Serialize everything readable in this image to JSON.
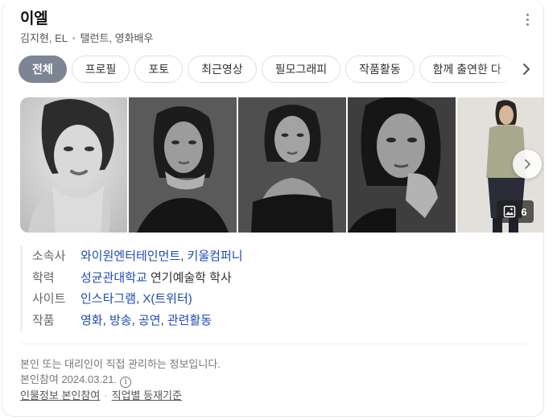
{
  "header": {
    "title": "이엘",
    "subtitle_names": "김지현, EL",
    "subtitle_role": "탤런트, 영화배우"
  },
  "tabs": [
    {
      "label": "전체",
      "active": true
    },
    {
      "label": "프로필"
    },
    {
      "label": "포토"
    },
    {
      "label": "최근영상"
    },
    {
      "label": "필모그래피"
    },
    {
      "label": "작품활동"
    },
    {
      "label": "함께 출연한 다"
    }
  ],
  "gallery": {
    "photo_count": "6",
    "icons": {
      "next": "chevron-right-icon",
      "count": "image-icon"
    }
  },
  "info": [
    {
      "label": "소속사",
      "values": [
        {
          "text": "와이원엔터테인먼트",
          "link": true
        },
        {
          "text": ", ",
          "link": false
        },
        {
          "text": "키울컴퍼니",
          "link": true
        }
      ]
    },
    {
      "label": "학력",
      "values": [
        {
          "text": "성균관대학교",
          "link": true
        },
        {
          "text": " 연기예술학 학사",
          "link": false
        }
      ]
    },
    {
      "label": "사이트",
      "values": [
        {
          "text": "인스타그램",
          "link": true
        },
        {
          "text": ", ",
          "link": false
        },
        {
          "text": "X(트위터)",
          "link": true
        }
      ]
    },
    {
      "label": "작품",
      "values": [
        {
          "text": "영화",
          "link": true
        },
        {
          "text": ", ",
          "link": false
        },
        {
          "text": "방송",
          "link": true
        },
        {
          "text": ", ",
          "link": false
        },
        {
          "text": "공연",
          "link": true
        },
        {
          "text": ", ",
          "link": false
        },
        {
          "text": "관련활동",
          "link": true
        }
      ]
    }
  ],
  "footer": {
    "notice": "본인 또는 대리인이 직접 관리하는 정보입니다.",
    "participation": "본인참여 2024.03.21.",
    "link_self": "인물정보 본인참여",
    "link_criteria": "직업별 등재기준"
  },
  "colors": {
    "accent_link": "#1d4bb0",
    "active_tab": "#7d8594"
  }
}
